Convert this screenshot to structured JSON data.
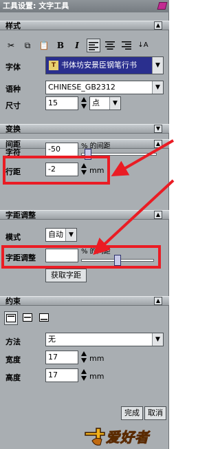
{
  "window": {
    "title": "工具设置: 文字工具"
  },
  "sections": {
    "style": "样式",
    "transform": "变换",
    "spacing": "间距",
    "kerning": "字距调整",
    "constraints": "约束"
  },
  "style": {
    "font_label": "字体",
    "font_value": "书体坊安景臣钢笔行书",
    "language_label": "语种",
    "language_value": "CHINESE_GB2312",
    "size_label": "尺寸",
    "size_value": "15",
    "size_unit": "点"
  },
  "spacing": {
    "char_label": "字符",
    "char_value": "-50",
    "char_suffix": "% 的间距",
    "line_label": "行距",
    "line_value": "-2",
    "line_unit": "mm"
  },
  "kerning": {
    "mode_label": "模式",
    "mode_value": "自动",
    "kern_label": "字距调整",
    "kern_value": "",
    "kern_suffix": "% 的间距",
    "fetch_button": "获取字距"
  },
  "constraints": {
    "method_label": "方法",
    "method_value": "无",
    "width_label": "宽度",
    "width_value": "17",
    "width_unit": "mm",
    "height_label": "高度",
    "height_value": "17",
    "height_unit": "mm"
  },
  "footer": {
    "ok": "完成",
    "cancel": "取消"
  },
  "logo": {
    "text": "爱好者"
  },
  "slider_levels": {
    "char_spacing": 0.05,
    "kerning": 0.5
  },
  "colors": {
    "highlight": "#ea1c24",
    "panel": "#a9aeb2",
    "font_field_bg": "#2a2f8e"
  }
}
